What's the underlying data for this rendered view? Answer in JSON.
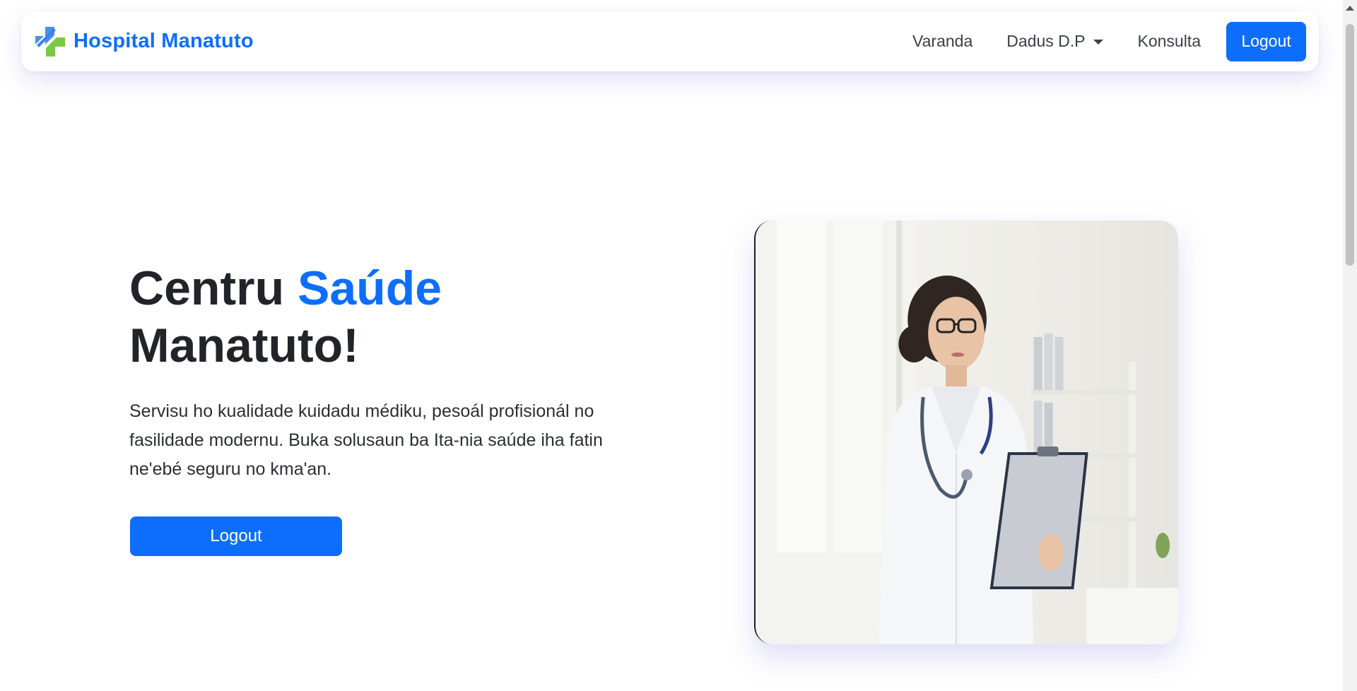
{
  "navbar": {
    "brand": "Hospital Manatuto",
    "links": [
      {
        "label": "Varanda"
      },
      {
        "label": "Dadus D.P"
      },
      {
        "label": "Konsulta"
      }
    ],
    "logout_label": "Logout"
  },
  "hero": {
    "title_part1": "Centru ",
    "title_accent": "Saúde",
    "title_part2": "Manatuto!",
    "description": "Servisu ho kualidade kuidadu médiku, pesoál profisionál no fasilidade modernu. Buka solusaun ba Ita-nia saúde iha fatin ne'ebé seguru no kma'an.",
    "button_label": "Logout"
  },
  "colors": {
    "primary": "#0d6efd",
    "logo_blue": "#3b82f6",
    "logo_green": "#7ac943",
    "text_dark": "#212529"
  }
}
